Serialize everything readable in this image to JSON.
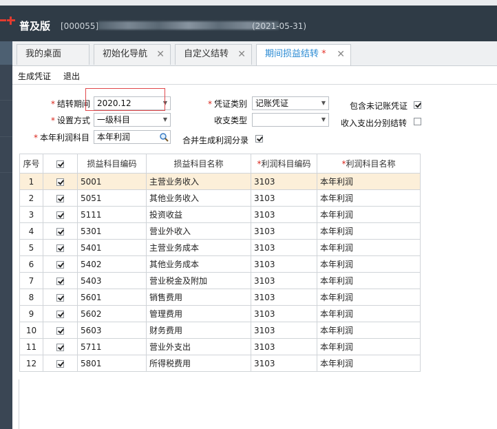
{
  "header": {
    "edition": "普及版",
    "company_prefix": "[000055]",
    "period": "(2021-05-31)"
  },
  "tabs": [
    {
      "label": "我的桌面",
      "closable": false
    },
    {
      "label": "初始化导航",
      "closable": true
    },
    {
      "label": "自定义结转",
      "closable": true
    },
    {
      "label": "期间损益结转",
      "closable": true,
      "modified": "*"
    }
  ],
  "toolbar": {
    "generate_label": "生成凭证",
    "exit_label": "退出"
  },
  "form": {
    "period_label": "结转期间",
    "period_value": "2020.12",
    "method_label": "设置方式",
    "method_value": "一级科目",
    "profit_account_label": "本年利润科目",
    "profit_account_value": "本年利润",
    "voucher_type_label": "凭证类别",
    "voucher_type_value": "记账凭证",
    "income_type_label": "收支类型",
    "income_type_value": "",
    "merge_label": "合并生成利润分录",
    "merge_checked": true,
    "include_unposted_label": "包含未记账凭证",
    "include_unposted_checked": true,
    "separate_label": "收入支出分别结转",
    "separate_checked": false,
    "required_mark": "*"
  },
  "grid": {
    "headers": [
      "序号",
      "",
      "损益科目编码",
      "损益科目名称",
      "利润科目编码",
      "利润科目名称"
    ],
    "rows": [
      {
        "no": "1",
        "code": "5001",
        "name": "主营业务收入",
        "pcode": "3103",
        "pname": "本年利润"
      },
      {
        "no": "2",
        "code": "5051",
        "name": "其他业务收入",
        "pcode": "3103",
        "pname": "本年利润"
      },
      {
        "no": "3",
        "code": "5111",
        "name": "投资收益",
        "pcode": "3103",
        "pname": "本年利润"
      },
      {
        "no": "4",
        "code": "5301",
        "name": "营业外收入",
        "pcode": "3103",
        "pname": "本年利润"
      },
      {
        "no": "5",
        "code": "5401",
        "name": "主营业务成本",
        "pcode": "3103",
        "pname": "本年利润"
      },
      {
        "no": "6",
        "code": "5402",
        "name": "其他业务成本",
        "pcode": "3103",
        "pname": "本年利润"
      },
      {
        "no": "7",
        "code": "5403",
        "name": "营业税金及附加",
        "pcode": "3103",
        "pname": "本年利润"
      },
      {
        "no": "8",
        "code": "5601",
        "name": "销售费用",
        "pcode": "3103",
        "pname": "本年利润"
      },
      {
        "no": "9",
        "code": "5602",
        "name": "管理费用",
        "pcode": "3103",
        "pname": "本年利润"
      },
      {
        "no": "10",
        "code": "5603",
        "name": "财务费用",
        "pcode": "3103",
        "pname": "本年利润"
      },
      {
        "no": "11",
        "code": "5711",
        "name": "营业外支出",
        "pcode": "3103",
        "pname": "本年利润"
      },
      {
        "no": "12",
        "code": "5801",
        "name": "所得税费用",
        "pcode": "3103",
        "pname": "本年利润"
      }
    ]
  },
  "colors": {
    "header_bg": "#2f3b46",
    "accent": "#2a8ad3",
    "required": "#d9261c",
    "highlight_row": "#fcefd9"
  },
  "icons": {
    "close": "close-icon",
    "search": "magnifier-icon",
    "dropdown": "dropdown-arrow-icon",
    "logo": "plus-logo-icon"
  }
}
